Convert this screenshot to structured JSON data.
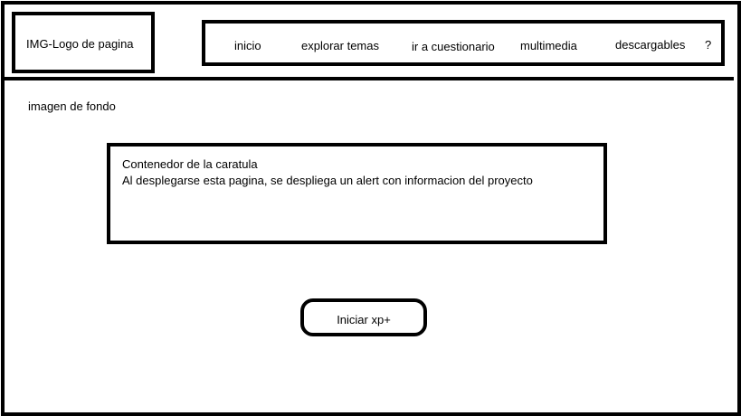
{
  "header": {
    "logo_text": "IMG-Logo de pagina",
    "nav": {
      "items": [
        {
          "label": "inicio"
        },
        {
          "label": "explorar temas"
        },
        {
          "label": "ir a cuestionario"
        },
        {
          "label": "multimedia"
        },
        {
          "label": "descargables"
        },
        {
          "label": "?"
        }
      ]
    }
  },
  "main": {
    "background_label": "imagen de fondo",
    "cover": {
      "title": "Contenedor de la caratula",
      "description": "Al desplegarse esta pagina, se despliega un alert con informacion del proyecto"
    },
    "start_button_label": "Iniciar xp+"
  }
}
